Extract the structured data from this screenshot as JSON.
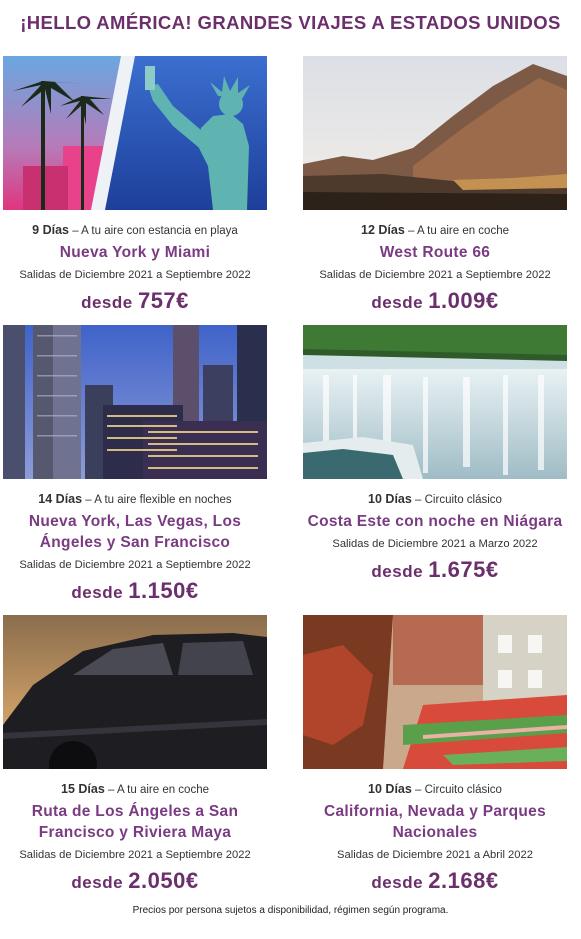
{
  "header": {
    "title": "¡HELLO AMÉRICA! GRANDES VIAJES A ESTADOS UNIDOS"
  },
  "trips": [
    {
      "days": "9 Días",
      "sep": " – ",
      "type": "A tu aire con estancia en playa",
      "name": "Nueva York y Miami",
      "dates": "Salidas de Diciembre 2021 a Septiembre 2022",
      "price_prefix": "desde ",
      "price": "757€",
      "image": "miami-liberty-photo"
    },
    {
      "days": "12 Días",
      "sep": " – ",
      "type": "A tu aire en coche",
      "name": "West Route 66",
      "dates": "Salidas de Diciembre 2021 a Septiembre 2022",
      "price_prefix": "desde ",
      "price": "1.009€",
      "image": "desert-mountains-photo"
    },
    {
      "days": "14 Días",
      "sep": " – ",
      "type": "A tu aire flexible en noches",
      "name": "Nueva York, Las Vegas, Los Ángeles y San Francisco",
      "dates": "Salidas de Diciembre 2021 a Septiembre 2022",
      "price_prefix": "desde ",
      "price": "1.150€",
      "image": "city-skyline-photo"
    },
    {
      "days": "10 Días",
      "sep": " – ",
      "type": "Circuito clásico",
      "name": "Costa Este con noche en Niágara",
      "dates": "Salidas de Diciembre 2021 a Marzo 2022",
      "price_prefix": "desde ",
      "price": "1.675€",
      "image": "niagara-falls-photo"
    },
    {
      "days": "15 Días",
      "sep": " – ",
      "type": "A tu aire en coche",
      "name": "Ruta de Los Ángeles a San Francisco y Riviera Maya",
      "dates": "Salidas de Diciembre 2021 a Septiembre 2022",
      "price_prefix": "desde ",
      "price": "2.050€",
      "image": "car-sunset-photo"
    },
    {
      "days": "10 Días",
      "sep": " – ",
      "type": "Circuito clásico",
      "name": "California, Nevada y Parques Nacionales",
      "dates": "Salidas de Diciembre 2021 a Abril 2022",
      "price_prefix": "desde ",
      "price": "2.168€",
      "image": "lombard-street-photo"
    }
  ],
  "footer": {
    "note": "Precios por persona sujetos a disponibilidad, régimen según programa."
  }
}
